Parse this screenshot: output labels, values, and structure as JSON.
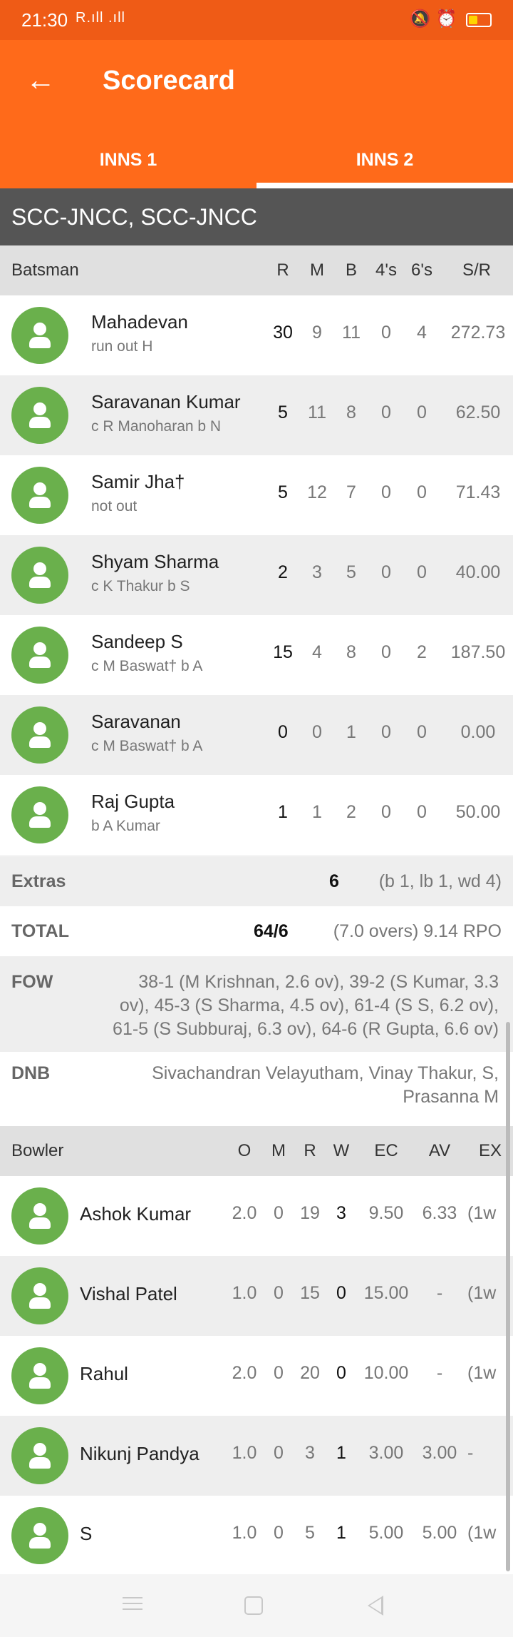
{
  "status_bar": {
    "time": "21:30",
    "signal": "R.ıll .ıll",
    "dots": "···"
  },
  "app_bar": {
    "title": "Scorecard",
    "tabs": [
      "INNS 1",
      "INNS 2"
    ],
    "active_tab": 1
  },
  "team": "SCC-JNCC, SCC-JNCC",
  "batting": {
    "columns": [
      "Batsman",
      "R",
      "M",
      "B",
      "4's",
      "6's",
      "S/R"
    ],
    "rows": [
      {
        "name": "Mahadevan",
        "dismissal": "run out H",
        "r": "30",
        "m": "9",
        "b": "11",
        "fours": "0",
        "sixes": "4",
        "sr": "272.73"
      },
      {
        "name": "Saravanan Kumar",
        "dismissal": "c R Manoharan b N",
        "r": "5",
        "m": "11",
        "b": "8",
        "fours": "0",
        "sixes": "0",
        "sr": "62.50"
      },
      {
        "name": "Samir Jha†",
        "dismissal": "not out",
        "r": "5",
        "m": "12",
        "b": "7",
        "fours": "0",
        "sixes": "0",
        "sr": "71.43"
      },
      {
        "name": "Shyam Sharma",
        "dismissal": "c K Thakur b S",
        "r": "2",
        "m": "3",
        "b": "5",
        "fours": "0",
        "sixes": "0",
        "sr": "40.00"
      },
      {
        "name": "Sandeep S",
        "dismissal": "c M Baswat† b A",
        "r": "15",
        "m": "4",
        "b": "8",
        "fours": "0",
        "sixes": "2",
        "sr": "187.50"
      },
      {
        "name": "Saravanan",
        "dismissal": "c M Baswat† b A",
        "r": "0",
        "m": "0",
        "b": "1",
        "fours": "0",
        "sixes": "0",
        "sr": "0.00"
      },
      {
        "name": "Raj Gupta",
        "dismissal": "b A Kumar",
        "r": "1",
        "m": "1",
        "b": "2",
        "fours": "0",
        "sixes": "0",
        "sr": "50.00"
      }
    ]
  },
  "extras": {
    "label": "Extras",
    "value": "6",
    "detail": "(b 1, lb 1, wd 4)"
  },
  "total": {
    "label": "TOTAL",
    "value": "64/6",
    "detail": "(7.0 overs) 9.14 RPO"
  },
  "fow": {
    "label": "FOW",
    "lines": [
      "38-1 (M Krishnan, 2.6 ov), 39-2 (S Kumar, 3.3",
      "ov), 45-3 (S Sharma, 4.5 ov), 61-4 (S S, 6.2 ov),",
      "61-5 (S Subburaj, 6.3 ov), 64-6 (R Gupta, 6.6 ov)"
    ]
  },
  "dnb": {
    "label": "DNB",
    "lines": [
      "Sivachandran Velayutham, Vinay Thakur, S,",
      "Prasanna M"
    ]
  },
  "bowling": {
    "columns": [
      "Bowler",
      "O",
      "M",
      "R",
      "W",
      "EC",
      "AV",
      "EX"
    ],
    "rows": [
      {
        "name": "Ashok Kumar",
        "o": "2.0",
        "m": "0",
        "r": "19",
        "w": "3",
        "ec": "9.50",
        "av": "6.33",
        "ex": "(1w"
      },
      {
        "name": "Vishal Patel",
        "o": "1.0",
        "m": "0",
        "r": "15",
        "w": "0",
        "ec": "15.00",
        "av": "-",
        "ex": "(1w"
      },
      {
        "name": "Rahul",
        "o": "2.0",
        "m": "0",
        "r": "20",
        "w": "0",
        "ec": "10.00",
        "av": "-",
        "ex": "(1w"
      },
      {
        "name": "Nikunj Pandya",
        "o": "1.0",
        "m": "0",
        "r": "3",
        "w": "1",
        "ec": "3.00",
        "av": "3.00",
        "ex": "-"
      },
      {
        "name": "S",
        "o": "1.0",
        "m": "0",
        "r": "5",
        "w": "1",
        "ec": "5.00",
        "av": "5.00",
        "ex": "(1w"
      }
    ]
  },
  "colors": {
    "primary": "#ff6a1a",
    "status": "#ef5b16",
    "team_bar": "#555555",
    "avatar": "#6ab04c"
  }
}
